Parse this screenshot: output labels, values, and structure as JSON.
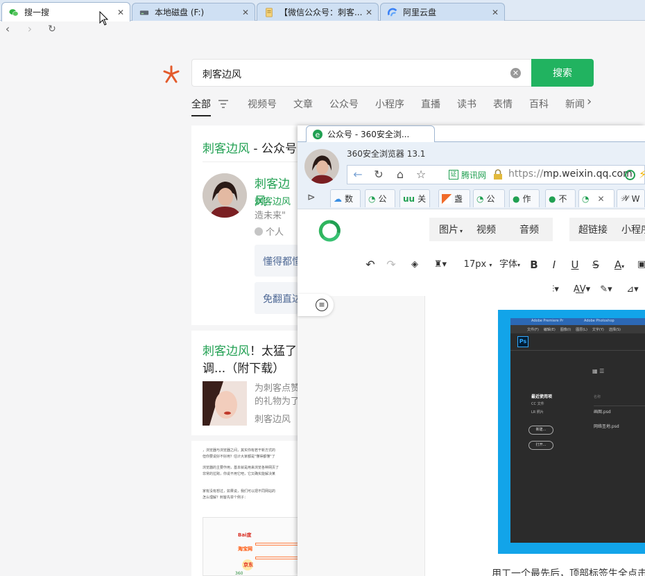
{
  "browser": {
    "tabs": [
      {
        "label": "搜一搜",
        "icon": "wechat-icon",
        "active": true
      },
      {
        "label": "本地磁盘 (F:)",
        "icon": "drive-icon"
      },
      {
        "label": "【微信公众号：刺客...",
        "icon": "document-icon"
      },
      {
        "label": "阿里云盘",
        "icon": "aliyun-drive-icon"
      }
    ],
    "close_glyph": "✕"
  },
  "nav": {
    "back": "‹",
    "forward": "›",
    "reload": "↻"
  },
  "search": {
    "query": "刺客边风",
    "button": "搜索",
    "categories": [
      "全部",
      "视频号",
      "文章",
      "公众号",
      "小程序",
      "直播",
      "读书",
      "表情",
      "百科",
      "新闻"
    ]
  },
  "results": {
    "account": {
      "title_highlight": "刺客边风",
      "title_rest": " - 公众号",
      "name": "刺客边风",
      "sub_name": "刺客边风",
      "desc": "造未来\"",
      "tag": "个人",
      "btn1": "懂得都懂",
      "btn2": "免翻直达"
    },
    "article": {
      "title_highlight": "刺客边风",
      "title_rest": "！太猛了",
      "title_line2": "调...（附下载）",
      "desc_line1": "为刺客点赞",
      "desc_line2": "的礼物为了",
      "source": "刺客边风"
    },
    "snippet": {
      "lines": [
        "，浏览器与浏览器之间，其实你有若干新方式的",
        "但你要说好不好用？估计大家都是\"懂得都懂\"了",
        "浏览器的主要作用，基本就是用来浏览各种网页了",
        "非常的拉跨，你说不用它吧，它又确实能解决某",
        "家有没有想过，如果说，我们可以把不同网站的",
        "怎么理解？刺客先举个例子："
      ],
      "logos": [
        "Bai度",
        "淘宝网",
        "京东",
        "360"
      ]
    }
  },
  "inner_window": {
    "tab_label": "公众号 - 360安全浏...",
    "app_name": "360安全浏览器 13.1",
    "secure_label": "腾讯网",
    "url_prefix": "https://",
    "url_host": "mp.weixin.qq.com",
    "favorites": [
      {
        "label": "数",
        "icon": "cloud-icon"
      },
      {
        "label": "公",
        "icon": "wechat-mp-icon"
      },
      {
        "label": "关",
        "icon": "uu-icon"
      },
      {
        "label": "盏",
        "icon": "flag-icon"
      },
      {
        "label": "公",
        "icon": "wechat-mp-icon"
      },
      {
        "label": "作",
        "icon": "chat-icon"
      },
      {
        "label": "不",
        "icon": "chat-icon"
      },
      {
        "label": "",
        "icon": "wechat-mp-icon",
        "active": true
      },
      {
        "label": "W",
        "icon": "wiki-icon"
      }
    ],
    "editor": {
      "menu_group1": [
        "图片",
        "视频",
        "音频"
      ],
      "menu_group2": [
        "超链接",
        "小程序"
      ],
      "font_size": "17px",
      "font_family": "字体",
      "format": [
        "B",
        "I",
        "U",
        "S",
        "A"
      ],
      "ps_menu": [
        "文件(F)",
        "编辑(E)",
        "图像(I)",
        "图层(L)",
        "文字(Y)",
        "选择(S)"
      ],
      "ps_tabs": [
        "Adobe Premiere Pr",
        "Adobe Photoshop"
      ],
      "ps_recent_title": "最近使用项",
      "ps_recent": [
        "CC 文件",
        "LR 照片"
      ],
      "ps_buttons": [
        "新建...",
        "打开..."
      ],
      "ps_files_header": "名称",
      "ps_files": [
        "画图.psd",
        "网络圣地.psd"
      ],
      "bottom_text": "用工一个最先后，顶部标签生全点击"
    }
  }
}
